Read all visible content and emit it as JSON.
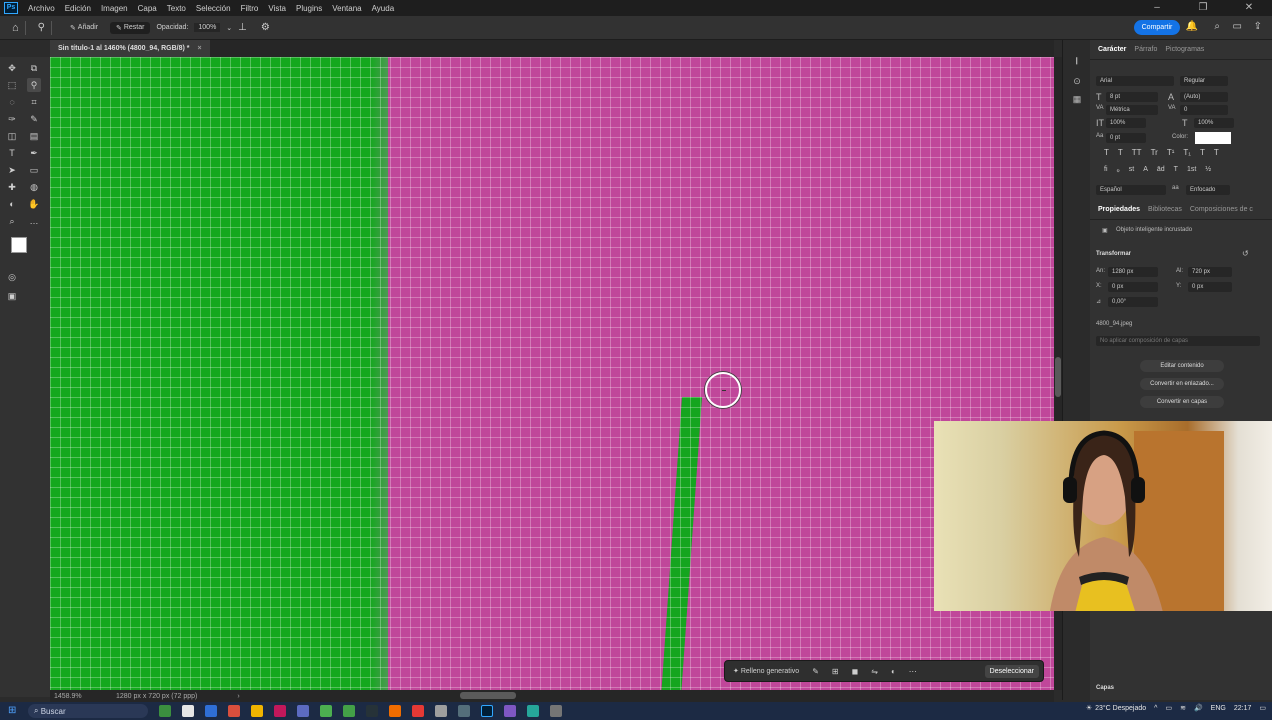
{
  "menubar": {
    "logo": "Ps",
    "items": [
      "Archivo",
      "Edición",
      "Imagen",
      "Capa",
      "Texto",
      "Selección",
      "Filtro",
      "Vista",
      "Plugins",
      "Ventana",
      "Ayuda"
    ]
  },
  "options": {
    "add_label": "Añadir",
    "subtract_label": "Restar",
    "opacity_label": "Opacidad:",
    "opacity_value": "100%",
    "share_label": "Compartir"
  },
  "document": {
    "tab_title": "Sin título-1 al 1460% (4800_94, RGB/8) *"
  },
  "status": {
    "zoom": "1458.9%",
    "doc_size": "1280 px x 720 px (72 ppp)"
  },
  "context_bar": {
    "generative_fill": "Relleno generativo",
    "deselect": "Deseleccionar"
  },
  "character_panel": {
    "tabs": [
      "Carácter",
      "Párrafo",
      "Pictogramas"
    ],
    "font_family": "Arial",
    "font_style": "Regular",
    "font_size": "8 pt",
    "leading": "(Auto)",
    "kerning": "Métrica",
    "tracking": "0",
    "vscale": "100%",
    "hscale": "100%",
    "baseline": "0 pt",
    "color_label": "Color:",
    "language": "Español",
    "aa": "Enfocado",
    "text_styles": [
      "T",
      "T",
      "TT",
      "Tr",
      "T¹",
      "T₁",
      "T",
      "T"
    ],
    "opentype": [
      "fi",
      "ℴ",
      "st",
      "A",
      "ād",
      "T",
      "1st",
      "½"
    ]
  },
  "properties_panel": {
    "tabs": [
      "Propiedades",
      "Bibliotecas",
      "Composiciones de c"
    ],
    "object_type": "Objeto inteligente incrustado",
    "transform_label": "Transformar",
    "w_label": "An:",
    "w_value": "1280 px",
    "h_label": "Al:",
    "h_value": "720 px",
    "x_label": "X:",
    "x_value": "0 px",
    "y_label": "Y:",
    "y_value": "0 px",
    "angle_value": "0,00°",
    "filename": "4800_94.jpeg",
    "comp_placeholder": "No aplicar composición de capas",
    "btn_edit": "Editar contenido",
    "btn_linked": "Convertir en enlazado...",
    "btn_layers": "Convertir en capas"
  },
  "layers_panel": {
    "title": "Capas"
  },
  "taskbar": {
    "search_placeholder": "Buscar",
    "weather": "23°C  Despejado",
    "lang": "ENG",
    "time": "22:17"
  },
  "colors": {
    "canvas_magenta": "#c0479a",
    "canvas_green": "#14a81e",
    "accent_blue": "#1473e6"
  }
}
